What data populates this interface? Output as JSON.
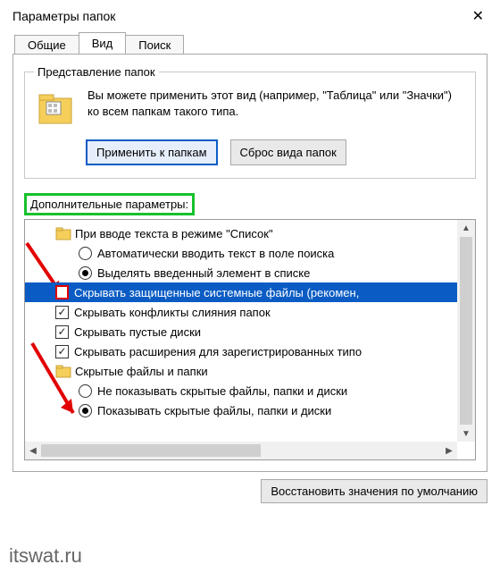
{
  "window": {
    "title": "Параметры папок"
  },
  "tabs": {
    "general": "Общие",
    "view": "Вид",
    "search": "Поиск"
  },
  "presentation": {
    "legend": "Представление папок",
    "text": "Вы можете применить этот вид (например, \"Таблица\" или \"Значки\") ко всем папкам такого типа.",
    "apply_btn": "Применить к папкам",
    "reset_btn": "Сброс вида папок"
  },
  "advanced": {
    "label": "Дополнительные параметры:",
    "items": {
      "group_list_input": "При вводе текста в режиме \"Список\"",
      "radio_auto_search": "Автоматически вводить текст в поле поиска",
      "radio_select_typed": "Выделять введенный элемент в списке",
      "cb_hide_protected": "Скрывать защищенные системные файлы (рекомен,",
      "cb_hide_merge": "Скрывать конфликты слияния папок",
      "cb_hide_empty": "Скрывать пустые диски",
      "cb_hide_ext": "Скрывать расширения для зарегистрированных типо",
      "group_hidden": "Скрытые файлы и папки",
      "radio_dont_show_hidden": "Не показывать скрытые файлы, папки и диски",
      "radio_show_hidden": "Показывать скрытые файлы, папки и диски"
    }
  },
  "restore_defaults_btn": "Восстановить значения по умолчанию",
  "watermark": "itswat.ru"
}
